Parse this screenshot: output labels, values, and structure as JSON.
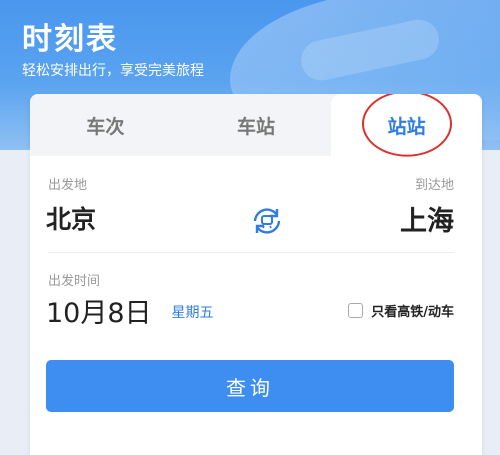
{
  "header": {
    "title": "时刻表",
    "subtitle": "轻松安排出行，享受完美旅程"
  },
  "tabs": [
    {
      "label": "车次",
      "active": false
    },
    {
      "label": "车站",
      "active": false
    },
    {
      "label": "站站",
      "active": true
    }
  ],
  "route": {
    "from_label": "出发地",
    "to_label": "到达地",
    "from_city": "北京",
    "to_city": "上海",
    "swap_icon": "swap-icon"
  },
  "date": {
    "label": "出发时间",
    "value": "10月8日",
    "weekday": "星期五"
  },
  "filter": {
    "high_speed_label": "只看高铁/动车",
    "checked": false
  },
  "search_button": "查询",
  "colors": {
    "accent": "#2f7de0",
    "button": "#3d8ef0",
    "annotation": "#d9322e"
  }
}
